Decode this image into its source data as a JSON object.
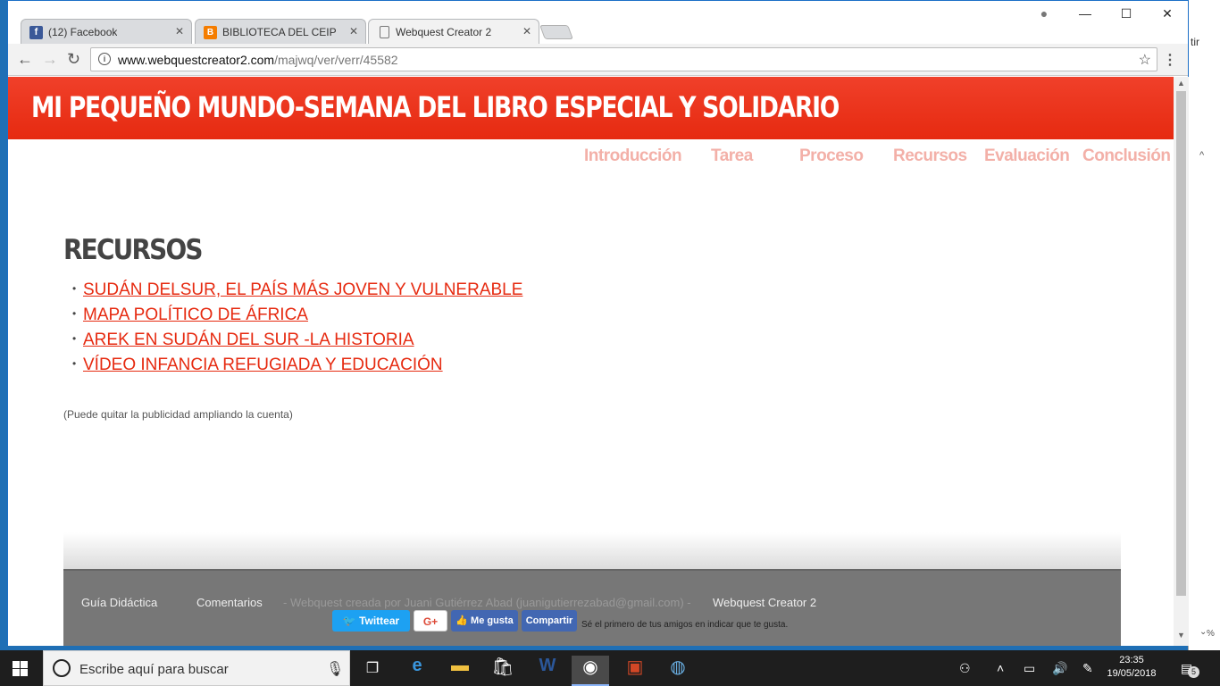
{
  "background_window": {
    "text": "tir",
    "pct": "%"
  },
  "tabs": [
    {
      "title": "(12) Facebook",
      "favicon_color": "#3b5998"
    },
    {
      "title": "BIBLIOTECA DEL CEIP ME",
      "favicon_color": "#f57d00"
    },
    {
      "title": "Webquest Creator 2",
      "favicon_color": "#ffffff"
    }
  ],
  "address": {
    "host": "www.webquestcreator2.com",
    "path": "/majwq/ver/verr/45582"
  },
  "site": {
    "title": "MI PEQUEÑO MUNDO-SEMANA DEL LIBRO ESPECIAL Y SOLIDARIO",
    "nav": [
      "Introducción",
      "Tarea",
      "Proceso",
      "Recursos",
      "Evaluación",
      "Conclusión"
    ],
    "section_title": "RECURSOS",
    "resources": [
      "SUDÁN DELSUR, EL PAÍS MÁS JOVEN Y VULNERABLE",
      "MAPA POLÍTICO DE ÁFRICA",
      "AREK EN SUDÁN DEL SUR -LA HISTORIA",
      "VÍDEO INFANCIA REFUGIADA Y EDUCACIÓN "
    ],
    "ad_note": "(Puede quitar la publicidad ampliando la cuenta)",
    "footer": {
      "guide": "Guía Didáctica",
      "comments": "Comentarios",
      "credit": "- Webquest creada por Juani Gutiérrez Abad (juanigutierrezabad@gmail.com) -",
      "brand": "Webquest Creator 2",
      "twitter": "Twittear",
      "gplus": "G+",
      "like": "Me gusta",
      "share": "Compartir",
      "social_note": "Sé el primero de tus amigos en indicar que te gusta."
    },
    "accent": "#e62a10"
  },
  "taskbar": {
    "search_placeholder": "Escribe aquí para buscar",
    "time": "23:35",
    "date": "19/05/2018",
    "notifications": "5"
  }
}
